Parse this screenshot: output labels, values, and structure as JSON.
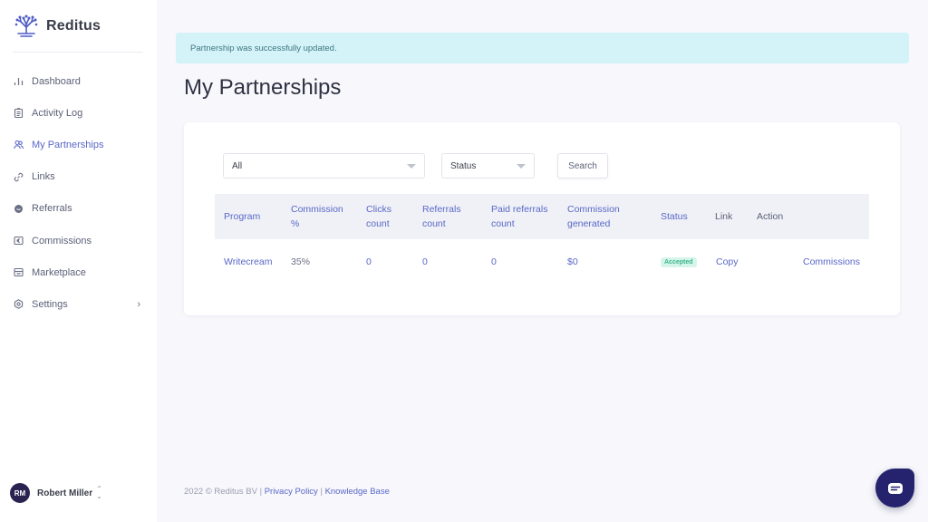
{
  "brand": {
    "name": "Reditus"
  },
  "sidebar": {
    "items": [
      {
        "label": "Dashboard",
        "icon": "bar-chart-icon",
        "active": false
      },
      {
        "label": "Activity Log",
        "icon": "clipboard-icon",
        "active": false
      },
      {
        "label": "My Partnerships",
        "icon": "users-icon",
        "active": true
      },
      {
        "label": "Links",
        "icon": "link-icon",
        "active": false
      },
      {
        "label": "Referrals",
        "icon": "chat-bubble-icon",
        "active": false
      },
      {
        "label": "Commissions",
        "icon": "euro-icon",
        "active": false
      },
      {
        "label": "Marketplace",
        "icon": "store-icon",
        "active": false
      },
      {
        "label": "Settings",
        "icon": "gear-icon",
        "active": false,
        "has_submenu": true
      }
    ],
    "user": {
      "initials": "RM",
      "name": "Robert Miller"
    }
  },
  "alert": {
    "message": "Partnership was successfully updated."
  },
  "page": {
    "title": "My Partnerships"
  },
  "filters": {
    "program_select": {
      "value": "All"
    },
    "status_select": {
      "value": "Status"
    },
    "search_label": "Search"
  },
  "table": {
    "columns": [
      {
        "label": "Program"
      },
      {
        "label": "Commission %"
      },
      {
        "label": "Clicks count"
      },
      {
        "label": "Referrals count"
      },
      {
        "label": "Paid referrals count"
      },
      {
        "label": "Commission generated"
      },
      {
        "label": "Status"
      },
      {
        "label": "Link"
      },
      {
        "label": "Action"
      }
    ],
    "rows": [
      {
        "program": "Writecream",
        "commission_pct": "35%",
        "clicks": "0",
        "referrals": "0",
        "paid_referrals": "0",
        "commission_generated": "$0",
        "status": "Accepted",
        "link": "Copy",
        "action": "Commissions"
      }
    ]
  },
  "footer": {
    "copyright": "2022 © Reditus BV | ",
    "privacy": "Privacy Policy",
    "separator": " | ",
    "knowledge": "Knowledge Base"
  },
  "colors": {
    "accent": "#5a67c8",
    "alert_bg": "#d3f3f8",
    "badge_bg": "#d6f5ea",
    "badge_text": "#3bb58a",
    "chat_button": "#25236e"
  }
}
